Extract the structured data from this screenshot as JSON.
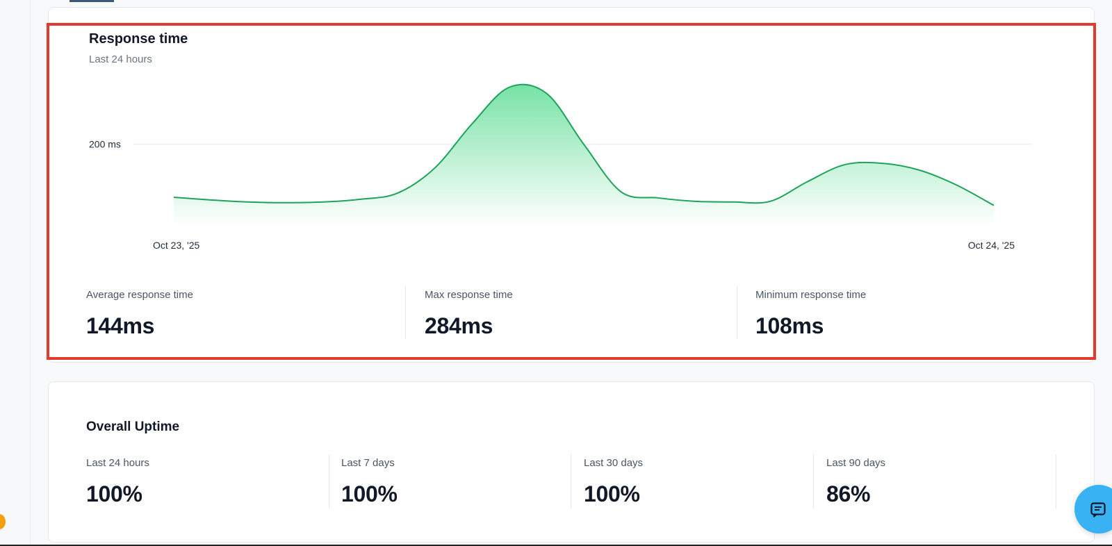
{
  "response_time": {
    "title": "Response time",
    "subtitle": "Last 24 hours",
    "stats": [
      {
        "label": "Average response time",
        "value": "144ms"
      },
      {
        "label": "Max response time",
        "value": "284ms"
      },
      {
        "label": "Minimum response time",
        "value": "108ms"
      }
    ]
  },
  "chart_data": {
    "type": "area",
    "title": "Response time",
    "subtitle": "Last 24 hours",
    "y_tick_labels": [
      "200 ms"
    ],
    "x_tick_labels": [
      "Oct 23, '25",
      "Oct 24, '25"
    ],
    "x": [
      0,
      1,
      2,
      3,
      4,
      5,
      6,
      7,
      8,
      9,
      10,
      11,
      12,
      13,
      14,
      15,
      16,
      17,
      18,
      19,
      20,
      21,
      22
    ],
    "values": [
      122,
      118,
      115,
      114,
      115,
      119,
      128,
      165,
      230,
      284,
      275,
      200,
      130,
      121,
      116,
      115,
      116,
      145,
      170,
      172,
      162,
      140,
      110
    ],
    "ylim": [
      80,
      300
    ],
    "grid": true,
    "colors": {
      "line": "#1ea35a",
      "fill_top": "#6fe0a0",
      "fill_bottom": "#ffffff"
    }
  },
  "uptime": {
    "title": "Overall Uptime",
    "stats": [
      {
        "label": "Last 24 hours",
        "value": "100%"
      },
      {
        "label": "Last 7 days",
        "value": "100%"
      },
      {
        "label": "Last 30 days",
        "value": "100%"
      },
      {
        "label": "Last 90 days",
        "value": "86%"
      }
    ]
  },
  "chat_button": {
    "icon": "chat-icon",
    "color": "#38b2f2"
  }
}
